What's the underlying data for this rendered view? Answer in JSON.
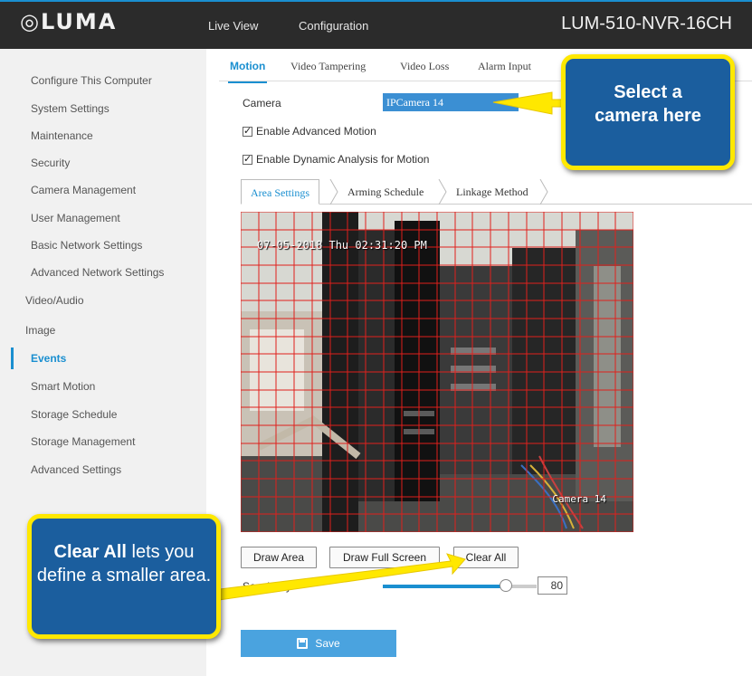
{
  "header": {
    "logo": "◎LUMA",
    "nav": [
      "Live View",
      "Configuration"
    ],
    "device_name": "LUM-510-NVR-16CH"
  },
  "sidebar": {
    "items": [
      {
        "label": "Configure This Computer"
      },
      {
        "label": "System Settings"
      },
      {
        "label": "Maintenance"
      },
      {
        "label": "Security"
      },
      {
        "label": "Camera Management"
      },
      {
        "label": "User Management"
      },
      {
        "label": "Basic Network Settings"
      },
      {
        "label": "Advanced Network Settings"
      },
      {
        "label": "Video/Audio"
      },
      {
        "label": "Image"
      },
      {
        "label": "Events",
        "active": true
      },
      {
        "label": "Smart Motion"
      },
      {
        "label": "Storage Schedule"
      },
      {
        "label": "Storage Management"
      },
      {
        "label": "Advanced Settings"
      }
    ]
  },
  "tabs": [
    "Motion",
    "Video Tampering",
    "Video Loss",
    "Alarm Input"
  ],
  "camera": {
    "label": "Camera",
    "selected": "IPCamera 14"
  },
  "checks": {
    "advanced_motion": {
      "label": "Enable Advanced Motion",
      "checked": true
    },
    "dynamic_analysis": {
      "label": "Enable Dynamic Analysis for Motion",
      "checked": true
    }
  },
  "subtabs": [
    "Area Settings",
    "Arming Schedule",
    "Linkage Method"
  ],
  "video": {
    "timestamp": "07-05-2018 Thu 02:31:20 PM",
    "camera_name": "Camera 14"
  },
  "buttons": {
    "draw_area": "Draw Area",
    "draw_full_screen": "Draw Full Screen",
    "clear_all": "Clear All",
    "save": "Save"
  },
  "sensitivity": {
    "label": "Sensitivity",
    "value": "80",
    "level": 0.8
  },
  "callouts": {
    "select_camera": "Select a camera here",
    "clear_all_bold": "Clear All",
    "clear_all_rest": " lets you define a smaller area."
  },
  "colors": {
    "accent": "#1a8fd0",
    "callout_bg": "#1b5e9e",
    "callout_border": "#ffe800",
    "grid": "#e0201c"
  }
}
